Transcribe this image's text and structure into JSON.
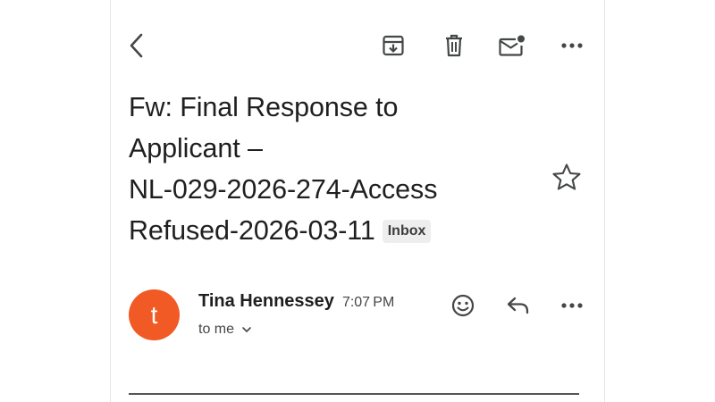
{
  "toolbar": {
    "icons": [
      "back-arrow-icon",
      "archive-icon",
      "delete-icon",
      "mark-unread-icon",
      "more-vert-icon"
    ]
  },
  "message": {
    "subject_lines": [
      "Fw: Final Response to",
      "Applicant –",
      "NL-029-2026-274-Access",
      "Refused-2026-03-11"
    ],
    "label_badge": "Inbox",
    "starred": false
  },
  "sender": {
    "initial": "t",
    "name": "Tina Hennessey",
    "time": "7:07 PM",
    "recipient": "to me",
    "avatar_color": "#f15a24"
  },
  "message_actions": {
    "icons": [
      "emoji-reaction-icon",
      "reply-icon",
      "more-horiz-icon"
    ]
  },
  "colors": {
    "icon": "#444746",
    "text": "#1f1f1f",
    "badge_bg": "#eeeeee"
  }
}
